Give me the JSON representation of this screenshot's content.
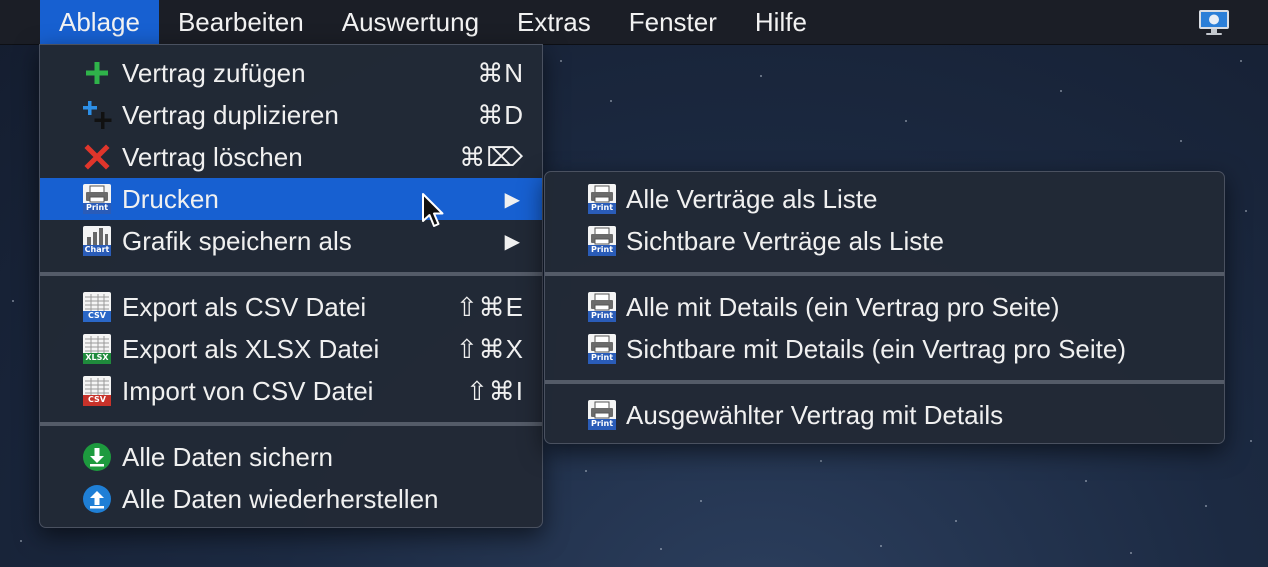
{
  "menubar": {
    "items": [
      "Ablage",
      "Bearbeiten",
      "Auswertung",
      "Extras",
      "Fenster",
      "Hilfe"
    ],
    "active_index": 0,
    "right_icon": "display-icon"
  },
  "ablage_menu": {
    "items": [
      {
        "label": "Vertrag zufügen",
        "shortcut": "⌘N",
        "icon": "plus-icon"
      },
      {
        "label": "Vertrag duplizieren",
        "shortcut": "⌘D",
        "icon": "duplicate-icon"
      },
      {
        "label": "Vertrag löschen",
        "shortcut": "⌘⌦",
        "icon": "delete-x-icon"
      },
      {
        "label": "Drucken",
        "icon": "print-icon",
        "submenu": true,
        "highlighted": true
      },
      {
        "label": "Grafik speichern als",
        "icon": "chart-icon",
        "submenu": true
      },
      {
        "label": "Export als CSV Datei",
        "shortcut": "⇧⌘E",
        "icon": "csv-export-icon"
      },
      {
        "label": "Export als XLSX Datei",
        "shortcut": "⇧⌘X",
        "icon": "xlsx-export-icon"
      },
      {
        "label": "Import von CSV Datei",
        "shortcut": "⇧⌘I",
        "icon": "csv-import-icon"
      },
      {
        "label": "Alle Daten sichern",
        "icon": "backup-download-icon"
      },
      {
        "label": "Alle Daten wiederherstellen",
        "icon": "restore-upload-icon"
      }
    ],
    "badges": {
      "print": "Print",
      "chart": "Chart",
      "csv": "CSV",
      "xlsx": "XLSX"
    },
    "submenu_arrow": "▶"
  },
  "drucken_submenu": {
    "items": [
      {
        "label": "Alle Verträge als Liste",
        "icon": "print-icon"
      },
      {
        "label": "Sichtbare Verträge als Liste",
        "icon": "print-icon"
      },
      {
        "label": "Alle mit Details (ein Vertrag pro Seite)",
        "icon": "print-icon"
      },
      {
        "label": "Sichtbare mit Details (ein Vertrag pro Seite)",
        "icon": "print-icon"
      },
      {
        "label": "Ausgewählter Vertrag mit Details",
        "icon": "print-icon"
      }
    ]
  },
  "colors": {
    "highlight": "#1760d1",
    "menu_bg": "#222936",
    "plus_green": "#2fb34a",
    "delete_red": "#e0352b",
    "csv_blue": "#2a67c7",
    "xlsx_green": "#1f8a3c",
    "import_red": "#c8322a",
    "backup_green": "#1d9a3e",
    "restore_blue": "#1f7fd6"
  }
}
